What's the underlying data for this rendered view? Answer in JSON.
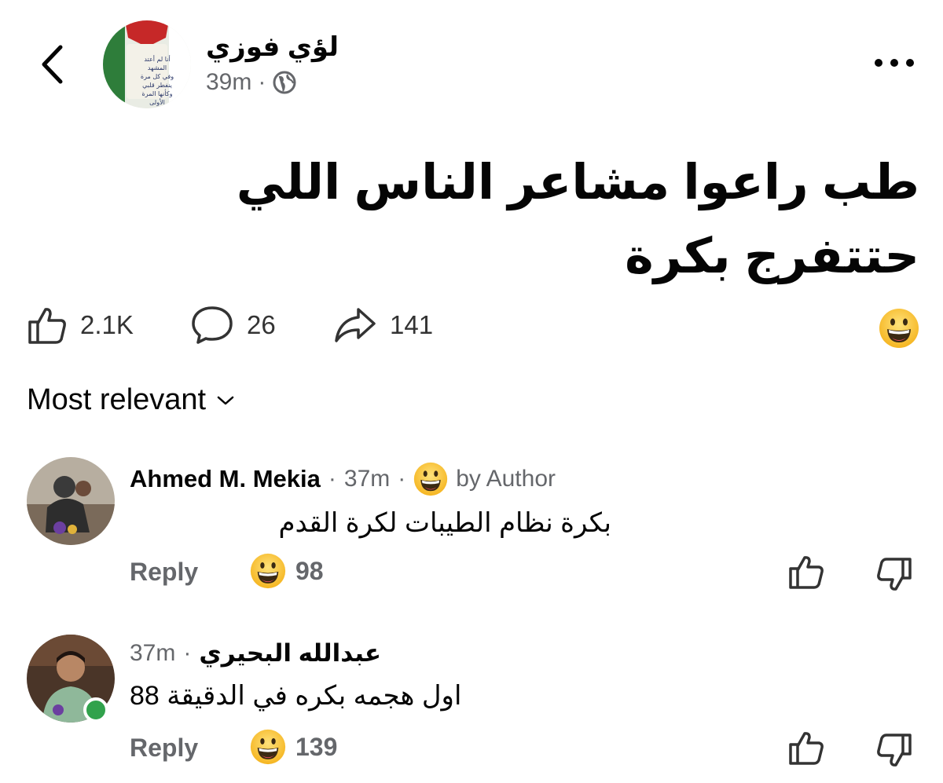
{
  "post": {
    "author_name": "لؤي فوزي",
    "time": "39m",
    "separator": "·",
    "audience_icon": "globe-icon",
    "text": "طب راعوا مشاعر الناس اللي حتتفرج بكرة",
    "avatar_text": [
      "أنا لم أعتد",
      "المشهد",
      "وفي كل مرة",
      "ينفطر قلبي",
      "وكأنها المرة",
      "الأولى"
    ]
  },
  "actions": {
    "likes": "2.1K",
    "comments": "26",
    "shares": "141",
    "reaction_icon": "grinning-face-icon"
  },
  "sort": {
    "label": "Most relevant"
  },
  "comments": [
    {
      "name": "Ahmed M. Mekia",
      "time": "37m",
      "separator": "·",
      "author_badge": "by Author",
      "text": "بكرة نظام الطيبات لكرة القدم",
      "reply_label": "Reply",
      "reaction_count": "98"
    },
    {
      "name": "عبدالله البحيري",
      "time": "37m",
      "separator": "·",
      "text": "اول هجمه بكره في الدقيقة 88",
      "reply_label": "Reply",
      "reaction_count": "139"
    }
  ],
  "colors": {
    "text_primary": "#050505",
    "text_secondary": "#65676b",
    "online": "#31a24c",
    "emoji_yellow": "#f7c02d"
  }
}
